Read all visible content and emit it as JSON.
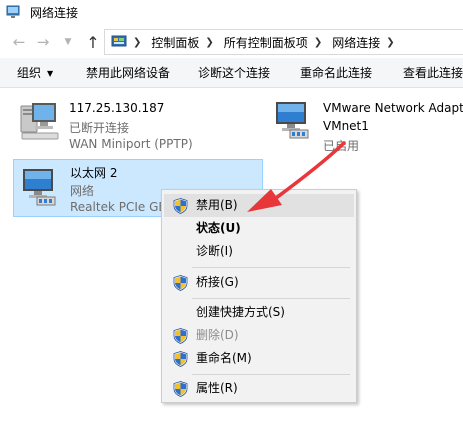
{
  "window": {
    "title": "网络连接",
    "icon": "network-connections-icon"
  },
  "address_bar": {
    "back_icon": "arrow-left-icon",
    "forward_icon": "arrow-right-icon",
    "recent_icon": "chevron-down-icon",
    "up_icon": "arrow-up-icon",
    "location_icon": "control-panel-icon",
    "breadcrumbs": [
      "控制面板",
      "所有控制面板项",
      "网络连接"
    ]
  },
  "command_bar": {
    "organize": "组织",
    "disable_device": "禁用此网络设备",
    "diagnose": "诊断这个连接",
    "rename": "重命名此连接",
    "view_status": "查看此连接"
  },
  "connections": [
    {
      "name": "117.25.130.187",
      "status": "已断开连接",
      "device": "WAN Miniport (PPTP)",
      "icon": "vpn-connection-icon"
    },
    {
      "name": "VMware Network Adapt",
      "status": "VMnet1",
      "device": "已启用",
      "icon": "network-adapter-icon"
    },
    {
      "name": "以太网 2",
      "status": "网络",
      "device": "Realtek PCIe GB",
      "icon": "ethernet-adapter-icon",
      "selected": true
    }
  ],
  "context_menu": {
    "items": [
      {
        "label": "禁用(B)",
        "shield": true,
        "highlighted": true
      },
      {
        "label": "状态(U)",
        "bold": true
      },
      {
        "label": "诊断(I)"
      },
      {
        "label": "桥接(G)",
        "shield": true
      },
      {
        "label": "创建快捷方式(S)"
      },
      {
        "label": "删除(D)",
        "shield": true,
        "disabled": true
      },
      {
        "label": "重命名(M)",
        "shield": true
      },
      {
        "label": "属性(R)",
        "shield": true
      }
    ]
  },
  "colors": {
    "selection_fill": "#cce8ff",
    "selection_border": "#99d1ff",
    "menu_background": "#f2f2f2",
    "menu_highlight": "#e1e1e1",
    "annotation_arrow": "#e8373a"
  }
}
